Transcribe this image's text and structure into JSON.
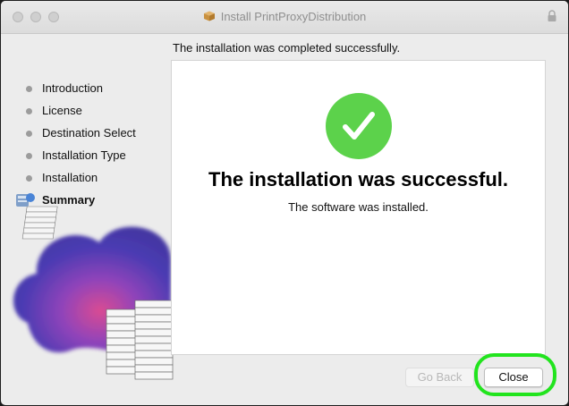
{
  "window": {
    "title": "Install PrintProxyDistribution"
  },
  "header": {
    "status_text": "The installation was completed successfully."
  },
  "main": {
    "title": "The installation was successful.",
    "subtitle": "The software was installed."
  },
  "sidebar": {
    "steps": [
      {
        "label": "Introduction"
      },
      {
        "label": "License"
      },
      {
        "label": "Destination Select"
      },
      {
        "label": "Installation Type"
      },
      {
        "label": "Installation"
      },
      {
        "label": "Summary"
      }
    ]
  },
  "buttons": {
    "go_back": "Go Back",
    "close": "Close"
  },
  "colors": {
    "success_green": "#5cd24b",
    "highlight_ring": "#22e41e"
  }
}
